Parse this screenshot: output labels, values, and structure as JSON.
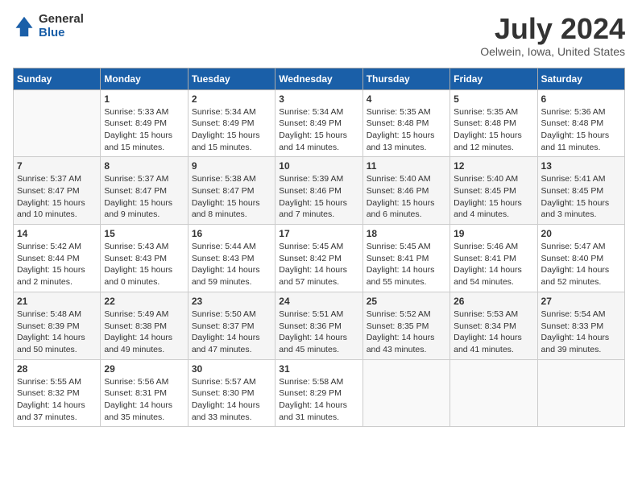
{
  "header": {
    "logo_general": "General",
    "logo_blue": "Blue",
    "title": "July 2024",
    "subtitle": "Oelwein, Iowa, United States"
  },
  "days_of_week": [
    "Sunday",
    "Monday",
    "Tuesday",
    "Wednesday",
    "Thursday",
    "Friday",
    "Saturday"
  ],
  "weeks": [
    [
      {
        "day": "",
        "info": ""
      },
      {
        "day": "1",
        "info": "Sunrise: 5:33 AM\nSunset: 8:49 PM\nDaylight: 15 hours\nand 15 minutes."
      },
      {
        "day": "2",
        "info": "Sunrise: 5:34 AM\nSunset: 8:49 PM\nDaylight: 15 hours\nand 15 minutes."
      },
      {
        "day": "3",
        "info": "Sunrise: 5:34 AM\nSunset: 8:49 PM\nDaylight: 15 hours\nand 14 minutes."
      },
      {
        "day": "4",
        "info": "Sunrise: 5:35 AM\nSunset: 8:48 PM\nDaylight: 15 hours\nand 13 minutes."
      },
      {
        "day": "5",
        "info": "Sunrise: 5:35 AM\nSunset: 8:48 PM\nDaylight: 15 hours\nand 12 minutes."
      },
      {
        "day": "6",
        "info": "Sunrise: 5:36 AM\nSunset: 8:48 PM\nDaylight: 15 hours\nand 11 minutes."
      }
    ],
    [
      {
        "day": "7",
        "info": "Sunrise: 5:37 AM\nSunset: 8:47 PM\nDaylight: 15 hours\nand 10 minutes."
      },
      {
        "day": "8",
        "info": "Sunrise: 5:37 AM\nSunset: 8:47 PM\nDaylight: 15 hours\nand 9 minutes."
      },
      {
        "day": "9",
        "info": "Sunrise: 5:38 AM\nSunset: 8:47 PM\nDaylight: 15 hours\nand 8 minutes."
      },
      {
        "day": "10",
        "info": "Sunrise: 5:39 AM\nSunset: 8:46 PM\nDaylight: 15 hours\nand 7 minutes."
      },
      {
        "day": "11",
        "info": "Sunrise: 5:40 AM\nSunset: 8:46 PM\nDaylight: 15 hours\nand 6 minutes."
      },
      {
        "day": "12",
        "info": "Sunrise: 5:40 AM\nSunset: 8:45 PM\nDaylight: 15 hours\nand 4 minutes."
      },
      {
        "day": "13",
        "info": "Sunrise: 5:41 AM\nSunset: 8:45 PM\nDaylight: 15 hours\nand 3 minutes."
      }
    ],
    [
      {
        "day": "14",
        "info": "Sunrise: 5:42 AM\nSunset: 8:44 PM\nDaylight: 15 hours\nand 2 minutes."
      },
      {
        "day": "15",
        "info": "Sunrise: 5:43 AM\nSunset: 8:43 PM\nDaylight: 15 hours\nand 0 minutes."
      },
      {
        "day": "16",
        "info": "Sunrise: 5:44 AM\nSunset: 8:43 PM\nDaylight: 14 hours\nand 59 minutes."
      },
      {
        "day": "17",
        "info": "Sunrise: 5:45 AM\nSunset: 8:42 PM\nDaylight: 14 hours\nand 57 minutes."
      },
      {
        "day": "18",
        "info": "Sunrise: 5:45 AM\nSunset: 8:41 PM\nDaylight: 14 hours\nand 55 minutes."
      },
      {
        "day": "19",
        "info": "Sunrise: 5:46 AM\nSunset: 8:41 PM\nDaylight: 14 hours\nand 54 minutes."
      },
      {
        "day": "20",
        "info": "Sunrise: 5:47 AM\nSunset: 8:40 PM\nDaylight: 14 hours\nand 52 minutes."
      }
    ],
    [
      {
        "day": "21",
        "info": "Sunrise: 5:48 AM\nSunset: 8:39 PM\nDaylight: 14 hours\nand 50 minutes."
      },
      {
        "day": "22",
        "info": "Sunrise: 5:49 AM\nSunset: 8:38 PM\nDaylight: 14 hours\nand 49 minutes."
      },
      {
        "day": "23",
        "info": "Sunrise: 5:50 AM\nSunset: 8:37 PM\nDaylight: 14 hours\nand 47 minutes."
      },
      {
        "day": "24",
        "info": "Sunrise: 5:51 AM\nSunset: 8:36 PM\nDaylight: 14 hours\nand 45 minutes."
      },
      {
        "day": "25",
        "info": "Sunrise: 5:52 AM\nSunset: 8:35 PM\nDaylight: 14 hours\nand 43 minutes."
      },
      {
        "day": "26",
        "info": "Sunrise: 5:53 AM\nSunset: 8:34 PM\nDaylight: 14 hours\nand 41 minutes."
      },
      {
        "day": "27",
        "info": "Sunrise: 5:54 AM\nSunset: 8:33 PM\nDaylight: 14 hours\nand 39 minutes."
      }
    ],
    [
      {
        "day": "28",
        "info": "Sunrise: 5:55 AM\nSunset: 8:32 PM\nDaylight: 14 hours\nand 37 minutes."
      },
      {
        "day": "29",
        "info": "Sunrise: 5:56 AM\nSunset: 8:31 PM\nDaylight: 14 hours\nand 35 minutes."
      },
      {
        "day": "30",
        "info": "Sunrise: 5:57 AM\nSunset: 8:30 PM\nDaylight: 14 hours\nand 33 minutes."
      },
      {
        "day": "31",
        "info": "Sunrise: 5:58 AM\nSunset: 8:29 PM\nDaylight: 14 hours\nand 31 minutes."
      },
      {
        "day": "",
        "info": ""
      },
      {
        "day": "",
        "info": ""
      },
      {
        "day": "",
        "info": ""
      }
    ]
  ]
}
